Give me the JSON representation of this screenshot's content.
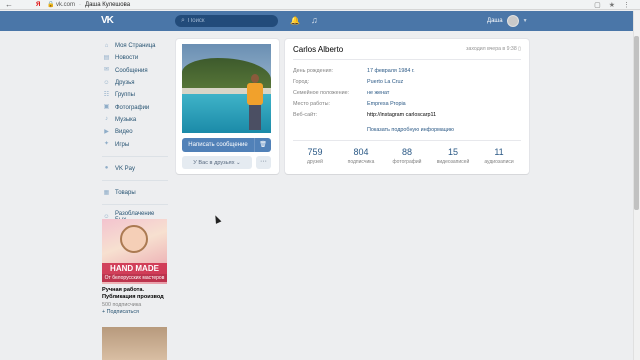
{
  "browser": {
    "back": "←",
    "yandex": "Я",
    "url": "vk.com",
    "page_title": "Даша Кулешова",
    "icons": [
      "bookmark-icon",
      "star-icon",
      "menu-icon"
    ]
  },
  "header": {
    "logo": "VK",
    "search_placeholder": "Поиск",
    "user_name": "Даша"
  },
  "sidebar": {
    "items": [
      {
        "icon": "home-icon",
        "label": "Моя Страница"
      },
      {
        "icon": "news-icon",
        "label": "Новости"
      },
      {
        "icon": "messages-icon",
        "label": "Сообщения"
      },
      {
        "icon": "friends-icon",
        "label": "Друзья"
      },
      {
        "icon": "groups-icon",
        "label": "Группы"
      },
      {
        "icon": "photos-icon",
        "label": "Фотографии"
      },
      {
        "icon": "music-icon",
        "label": "Музыка"
      },
      {
        "icon": "video-icon",
        "label": "Видео"
      },
      {
        "icon": "games-icon",
        "label": "Игры"
      }
    ],
    "extra": [
      {
        "icon": "vkpay-icon",
        "label": "VK Pay"
      },
      {
        "icon": "goods-icon",
        "label": "Товары"
      },
      {
        "icon": "community-icon",
        "label": "Разоблачение Бых..."
      }
    ],
    "ad": {
      "banner_text": "HAND MADE",
      "banner_subtext": "От белорусских мастеров",
      "title": "Ручная работа. Публикация производ",
      "subtitle": "500 подписчика",
      "subscribe": "+ Подписаться"
    }
  },
  "profile": {
    "message_button": "Написать сообщение",
    "friends_button": "У Вас в друзьях ⌄",
    "more_button": "···",
    "name": "Carlos Alberto",
    "online": "заходил вчера в 9:38 ▯",
    "fields": [
      {
        "key": "День рождения:",
        "value": "17 февраля 1984 г."
      },
      {
        "key": "Город:",
        "value": "Puerto La Cruz"
      },
      {
        "key": "Семейное положение:",
        "value": "не женат"
      },
      {
        "key": "Место работы:",
        "value": "Empresa Propia"
      },
      {
        "key": "Веб-сайт:",
        "value": "http://instagram carloscarp11"
      }
    ],
    "show_more": "Показать подробную информацию",
    "counters": [
      {
        "value": "759",
        "label": "друзей"
      },
      {
        "value": "804",
        "label": "подписчика"
      },
      {
        "value": "88",
        "label": "фотографий"
      },
      {
        "value": "15",
        "label": "видеозаписей"
      },
      {
        "value": "11",
        "label": "аудиозаписи"
      }
    ]
  },
  "colors": {
    "header_bg": "#4a76a8",
    "link": "#2a5885",
    "button": "#5181b8",
    "page_bg": "#edeef0"
  }
}
